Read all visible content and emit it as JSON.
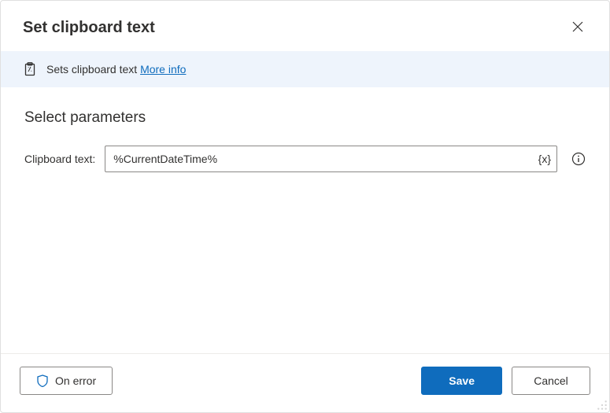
{
  "header": {
    "title": "Set clipboard text"
  },
  "banner": {
    "description": "Sets clipboard text",
    "more_info_label": "More info"
  },
  "section": {
    "title": "Select parameters"
  },
  "field": {
    "label": "Clipboard text:",
    "value": "%CurrentDateTime%",
    "variable_hint": "{x}"
  },
  "footer": {
    "on_error_label": "On error",
    "save_label": "Save",
    "cancel_label": "Cancel"
  }
}
